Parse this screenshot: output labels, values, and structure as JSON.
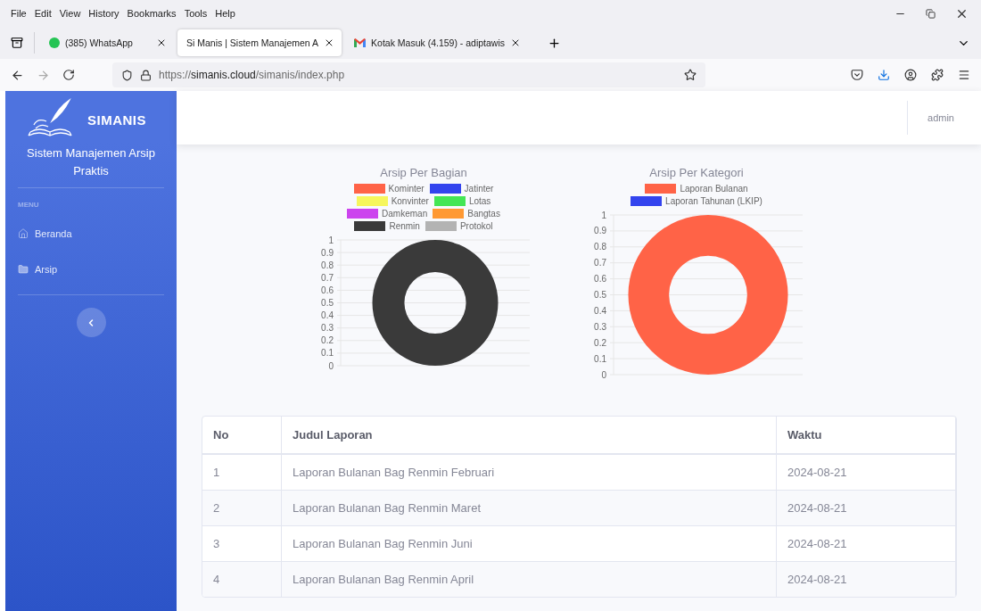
{
  "browser": {
    "menu": [
      "File",
      "Edit",
      "View",
      "History",
      "Bookmarks",
      "Tools",
      "Help"
    ],
    "tabs": [
      {
        "title": "(385) WhatsApp",
        "kind": "whatsapp",
        "selected": false
      },
      {
        "title": "Si Manis | Sistem Manajemen A",
        "kind": "blank",
        "selected": true
      },
      {
        "title": "Kotak Masuk (4.159) - adiptawis",
        "kind": "mail",
        "selected": false
      }
    ],
    "address": "https://**simanis.cloud**/simanis/index.php"
  },
  "sidebar": {
    "brand": "SIMANIS",
    "subtitle": "Sistem Manajemen Arsip Praktis",
    "heading": "MENU",
    "items": [
      {
        "label": "Beranda",
        "kind": "home"
      },
      {
        "label": "Arsip",
        "kind": "folder"
      }
    ]
  },
  "topbar": {
    "user": "admin"
  },
  "charts": [
    {
      "title": "Arsip Per Bagian",
      "legend": [
        {
          "name": "Kominter",
          "color": "#ff6347",
          "filled": false
        },
        {
          "name": "Jatinter",
          "color": "#3344ee",
          "filled": false
        },
        {
          "name": "Konvinter",
          "color": "#f6f65c",
          "filled": false
        },
        {
          "name": "Lotas",
          "color": "#44e655",
          "filled": false
        },
        {
          "name": "Damkeman",
          "color": "#cc44ee",
          "filled": false
        },
        {
          "name": "Bangtas",
          "color": "#ff9933",
          "filled": false
        },
        {
          "name": "Renmin",
          "color": "#3a3a3a",
          "filled": true
        },
        {
          "name": "Protokol",
          "color": "#b3b3b3",
          "filled": false
        }
      ],
      "y_axis_labels": [
        "1",
        "0.9",
        "0.8",
        "0.7",
        "0.6",
        "0.5",
        "0.4",
        "0.3",
        "0.2",
        "0.1",
        "0"
      ]
    },
    {
      "title": "Arsip Per Kategori",
      "legend": [
        {
          "name": "Laporan Bulanan",
          "color": "#ff6347",
          "filled": true
        },
        {
          "name": "Laporan Tahunan (LKIP)",
          "color": "#3344ee",
          "filled": false
        }
      ],
      "y_axis_labels": [
        "1",
        "0.9",
        "0.8",
        "0.7",
        "0.6",
        "0.5",
        "0.4",
        "0.3",
        "0.2",
        "0.1",
        "0"
      ]
    }
  ],
  "table": {
    "columns": [
      "No",
      "Judul Laporan",
      "Waktu"
    ],
    "rows": [
      [
        "1",
        "Laporan Bulanan Bag Renmin Februari",
        "2024-08-21"
      ],
      [
        "2",
        "Laporan Bulanan Bag Renmin Maret",
        "2024-08-21"
      ],
      [
        "3",
        "Laporan Bulanan Bag Renmin Juni",
        "2024-08-21"
      ],
      [
        "4",
        "Laporan Bulanan Bag Renmin April",
        "2024-08-21"
      ]
    ]
  }
}
